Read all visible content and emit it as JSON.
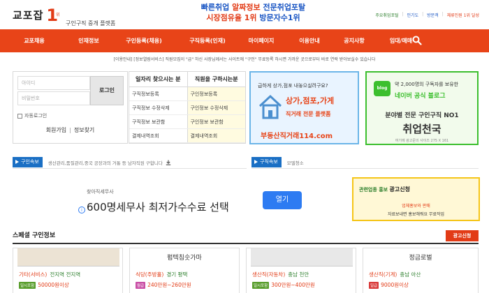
{
  "header": {
    "logo": "교포잡",
    "logo_one": "1",
    "logo_wi": "위",
    "tagline": "구인구직 중개 플랫폼",
    "promo_line1_a": "빠른취업",
    "promo_line1_b": "알짜정보",
    "promo_line1_c": "전문취업포탈",
    "promo_line2_a": "시장점유율 1위",
    "promo_line2_b": "방문자수1위",
    "top_links": [
      "주요취업포털",
      "인기도",
      "방문객",
      "체류인원 1위 달성"
    ]
  },
  "nav": {
    "items": [
      "교포채용",
      "인재정보",
      "구인등록(채용)",
      "구직등록(인재)",
      "마이페이지",
      "이용안내",
      "공지사항",
      "임대/매매"
    ]
  },
  "notice": "[이용안내] [정보열람서비스] 직원모집이 \"급\" 하신 사장님께서는 사이트에 \"구인\" 무료등록 하시면 가까운 곳으로부터 바로 연락 받아보실수 있습니다",
  "login": {
    "id_placeholder": "아이디",
    "pw_placeholder": "비밀번호",
    "login_button": "로그인",
    "auto_login": "자동로그인",
    "signup": "회원가입",
    "find_info": "정보찾기"
  },
  "menu_table": {
    "head_left": "일자리 찾으시는 분",
    "head_right": "직원을 구하시는분",
    "rows": [
      {
        "left": "구직정보등록",
        "right": "구인정보등록"
      },
      {
        "left": "구직정보 수정삭제",
        "right": "구인정보 수정삭제"
      },
      {
        "left": "구직정보 보관함",
        "right": "구인정보 보관함"
      },
      {
        "left": "결제내역조회",
        "right": "결제내역조회"
      }
    ]
  },
  "ad_estate": {
    "line1": "급하게 상가,점포 내놓으실려구요?",
    "line2": "상가,점포,가게",
    "line3": "직거래 전문 플랫폼",
    "line4": "부동산직거래114.com"
  },
  "ad_blog": {
    "badge": "blog",
    "line1": "약 2,000명의 구독자를 보유한",
    "line2": "네이버 공식 블로그",
    "line3": "분야별 전문 구인구직 NO1",
    "line4": "취업천국",
    "line5": "여기에 광고문의 사이즈 275 X 161"
  },
  "ticker_left": {
    "label": "구인속보",
    "text": "생산관리,품질관리,중국 공장과의 거통 등 남자직원 구합니다"
  },
  "ticker_right": {
    "label": "구직속보",
    "text": "모델청소"
  },
  "center_ad": {
    "small": "찾아직세무사",
    "big": "600명세무사 최저가수수료 선택",
    "button": "열기",
    "info_icon": "i"
  },
  "side_ad": {
    "label": "관련업종 홍보",
    "title": "광고신청",
    "line1": "업체홍보와 판매",
    "line2": "자료보내면 홍보해줘요 무료작업"
  },
  "special": {
    "title": "스페셜 구인정보",
    "apply_button": "광고신청",
    "cards": [
      {
        "head": "",
        "cat": "기타(서비스)",
        "loc": "전지역 전지역",
        "badge": "일시포함",
        "badge_type": "green",
        "amount": "50000원이상"
      },
      {
        "head": "펌텍침숫가마",
        "cat": "식당(주방홀)",
        "loc": "경기 평택",
        "badge": "월급",
        "badge_type": "pink",
        "amount": "240만원~260만원"
      },
      {
        "head": "",
        "cat": "생산직(자동차)",
        "loc": "충남 천안",
        "badge": "일시포함",
        "badge_type": "green",
        "amount": "300만원~400만원"
      },
      {
        "head": "정금로벌",
        "cat": "생산직(기계)",
        "loc": "충남 아산",
        "badge": "일급",
        "badge_type": "red",
        "amount": "9000원이상"
      }
    ]
  },
  "colors": {
    "brand_orange": "#e84418",
    "accent_blue": "#1a6fc4",
    "accent_green": "#3cbf2e"
  }
}
